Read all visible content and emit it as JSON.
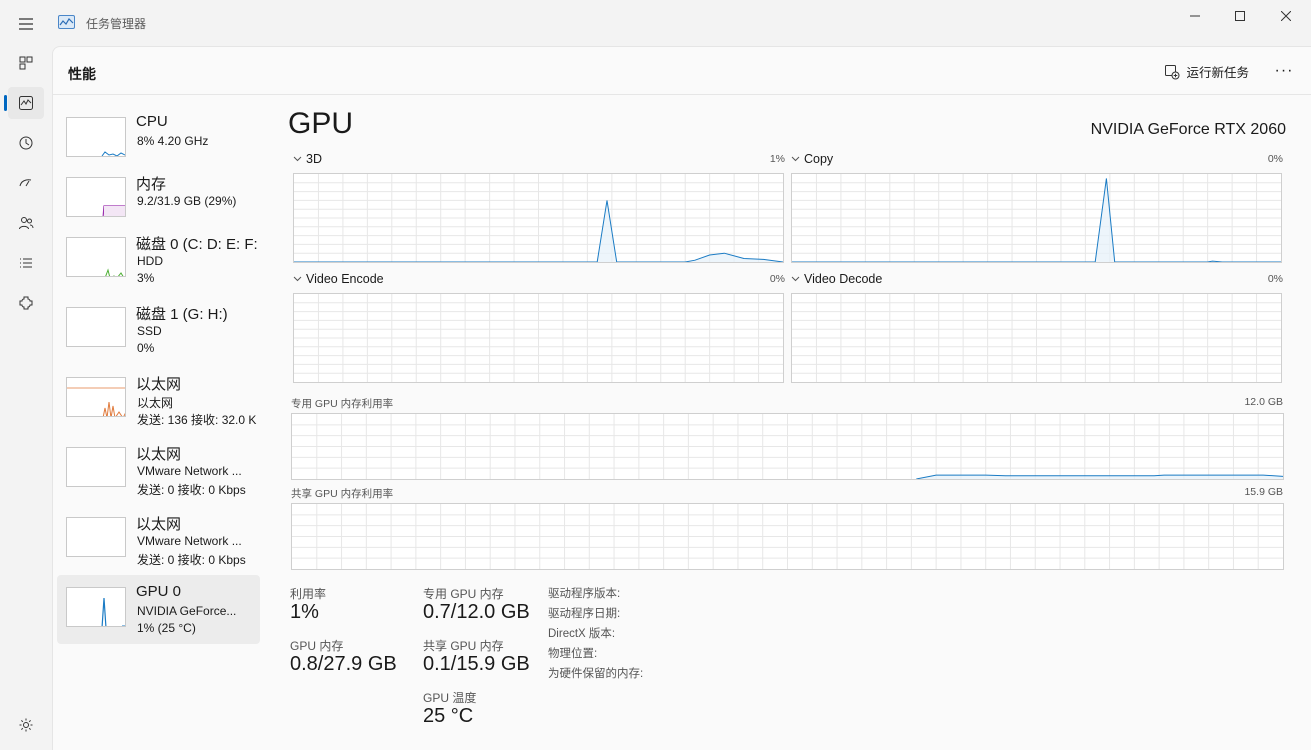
{
  "window": {
    "title": "任务管理器",
    "accent": "#0067c0"
  },
  "icons": {
    "menu": "hamburger-icon",
    "app": "task-manager-icon",
    "rail": [
      "processes-icon",
      "performance-icon",
      "app-history-icon",
      "startup-icon",
      "users-icon",
      "details-icon",
      "services-icon",
      "settings-icon"
    ]
  },
  "page": {
    "title": "性能",
    "run_task_label": "运行新任务",
    "more_label": "···"
  },
  "sidebar": {
    "items": [
      {
        "title": "CPU",
        "line1": "8%  4.20 GHz",
        "line2": "",
        "line3": "",
        "color": "#1a7bc4"
      },
      {
        "title": "内存",
        "line1": "9.2/31.9 GB (29%)",
        "line2": "",
        "line3": "",
        "color": "#9b2fae"
      },
      {
        "title": "磁盘 0 (C: D: E: F:",
        "line1": "HDD",
        "line2": "3%",
        "line3": "",
        "color": "#4caf32"
      },
      {
        "title": "磁盘 1 (G: H:)",
        "line1": "SSD",
        "line2": "0%",
        "line3": "",
        "color": "#4caf32"
      },
      {
        "title": "以太网",
        "line1": "以太网",
        "line2": "发送: 136 接收: 32.0 K",
        "line3": "",
        "color": "#e07a3c"
      },
      {
        "title": "以太网",
        "line1": "VMware Network ...",
        "line2": "发送: 0 接收: 0 Kbps",
        "line3": "",
        "color": "#e07a3c"
      },
      {
        "title": "以太网",
        "line1": "VMware Network ...",
        "line2": "发送: 0 接收: 0 Kbps",
        "line3": "",
        "color": "#e07a3c"
      },
      {
        "title": "GPU 0",
        "line1": "NVIDIA GeForce...",
        "line2": "1% (25 °C)",
        "line3": "",
        "color": "#1a7bc4"
      }
    ]
  },
  "main": {
    "title": "GPU",
    "model": "NVIDIA GeForce RTX 2060",
    "graphs": [
      {
        "label": "3D",
        "value": "1%"
      },
      {
        "label": "Copy",
        "value": "0%"
      },
      {
        "label": "Video Encode",
        "value": "0%"
      },
      {
        "label": "Video Decode",
        "value": "0%"
      }
    ],
    "dedicated_mem": {
      "label": "专用 GPU 内存利用率",
      "max": "12.0 GB"
    },
    "shared_mem": {
      "label": "共享 GPU 内存利用率",
      "max": "15.9 GB"
    },
    "stats": {
      "utilization": {
        "label": "利用率",
        "value": "1%"
      },
      "gpu_memory": {
        "label": "GPU 内存",
        "value": "0.8/27.9 GB"
      },
      "dedicated": {
        "label": "专用 GPU 内存",
        "value": "0.7/12.0 GB"
      },
      "shared": {
        "label": "共享 GPU 内存",
        "value": "0.1/15.9 GB"
      },
      "temperature": {
        "label": "GPU 温度",
        "value": "25 °C"
      }
    },
    "info": {
      "driver_version": "驱动程序版本:",
      "driver_date": "驱动程序日期:",
      "directx": "DirectX 版本:",
      "location": "物理位置:",
      "reserved": "为硬件保留的内存:"
    }
  },
  "colors": {
    "graph_line": "#1a7bc4",
    "graph_fill": "#e6f1fa",
    "grid": "#e7e7e7"
  }
}
